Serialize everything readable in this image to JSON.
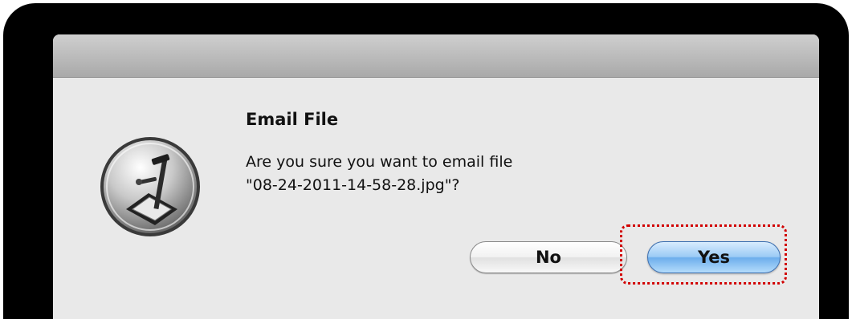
{
  "dialog": {
    "title": "Email File",
    "message": "Are you sure you want to email file\n\"08-24-2011-14-58-28.jpg\"?",
    "icon": "document-camera-icon",
    "buttons": {
      "no_label": "No",
      "yes_label": "Yes"
    }
  },
  "colors": {
    "frame": "#000000",
    "dialog_background": "#e9e9e9",
    "default_button": "#7db8f0",
    "highlight": "#d10000"
  }
}
